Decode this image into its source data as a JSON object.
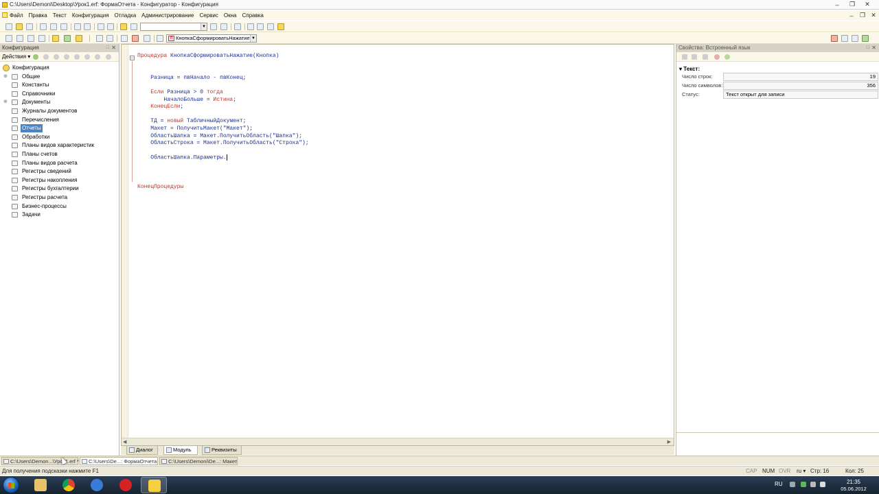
{
  "window": {
    "title": "C:\\Users\\Demoni\\Desktop\\Урок1.erf: ФормаОтчета - Конфигуратор - Конфигурация"
  },
  "menu": [
    "Файл",
    "Правка",
    "Текст",
    "Конфигурация",
    "Отладка",
    "Администрирование",
    "Сервис",
    "Окна",
    "Справка"
  ],
  "toolbar2": {
    "procedure_combo": "КнопкаСформироватьНажатие"
  },
  "left_panel": {
    "title": "Конфигурация",
    "actions_label": "Действия",
    "tree": [
      {
        "label": "Конфигурация",
        "root": true
      },
      {
        "label": "Общие",
        "expandable": true
      },
      {
        "label": "Константы"
      },
      {
        "label": "Справочники"
      },
      {
        "label": "Документы",
        "expandable": true
      },
      {
        "label": "Журналы документов"
      },
      {
        "label": "Перечисления"
      },
      {
        "label": "Отчеты",
        "selected": true
      },
      {
        "label": "Обработки"
      },
      {
        "label": "Планы видов характеристик"
      },
      {
        "label": "Планы счетов"
      },
      {
        "label": "Планы видов расчета"
      },
      {
        "label": "Регистры сведений"
      },
      {
        "label": "Регистры накопления"
      },
      {
        "label": "Регистры бухгалтерии"
      },
      {
        "label": "Регистры расчета"
      },
      {
        "label": "Бизнес-процессы"
      },
      {
        "label": "Задачи"
      }
    ]
  },
  "editor": {
    "code_lines": [
      {
        "text": "Процедура КнопкаСформироватьНажатие(Кнопка)",
        "indent": 0
      },
      {
        "text": "",
        "indent": 0
      },
      {
        "text": "",
        "indent": 0
      },
      {
        "text": "Разница = пвНачало - пвКонец;",
        "indent": 1
      },
      {
        "text": "",
        "indent": 0
      },
      {
        "text": "Если Разница > 0 тогда",
        "indent": 1
      },
      {
        "text": "НачалоБольше = Истина;",
        "indent": 2
      },
      {
        "text": "КонецЕсли;",
        "indent": 1
      },
      {
        "text": "",
        "indent": 0
      },
      {
        "text": "ТД = новый ТабличныйДокумент;",
        "indent": 1
      },
      {
        "text": "Макет = ПолучитьМакет(\"Макет\");",
        "indent": 1
      },
      {
        "text": "ОбластьШапка = Макет.ПолучитьОбласть(\"Шапка\");",
        "indent": 1
      },
      {
        "text": "ОбластьСтрока = Макет.ПолучитьОбласть(\"Строка\");",
        "indent": 1
      },
      {
        "text": "",
        "indent": 0
      },
      {
        "text": "ОбластьШапка.Параметры.",
        "indent": 1,
        "cursor": true
      },
      {
        "text": "",
        "indent": 0
      },
      {
        "text": "",
        "indent": 0
      },
      {
        "text": "",
        "indent": 0
      },
      {
        "text": "КонецПроцедуры",
        "indent": 0
      }
    ],
    "tabs": [
      "Диалог",
      "Модуль",
      "Реквизиты"
    ],
    "active_tab": "Модуль"
  },
  "right_panel": {
    "title": "Свойства: Встроенный язык",
    "group": "Текст:",
    "properties": [
      {
        "label": "Число строк:",
        "value": "19",
        "numeric": true
      },
      {
        "label": "Число символов:",
        "value": "356",
        "numeric": true
      },
      {
        "label": "Статус:",
        "value": "Текст открыт для записи",
        "numeric": false
      }
    ]
  },
  "window_tabs": [
    {
      "label": "C:\\Users\\Demon...\\Урок1.erf *"
    },
    {
      "label": "C:\\Users\\De...: ФормаОтчета",
      "active": true
    },
    {
      "label": "C:\\Users\\Demoni\\De...: Макет"
    }
  ],
  "status_bar": {
    "hint": "Для получения подсказки нажмите F1",
    "cap": "CAP",
    "num": "NUM",
    "ovr": "OVR",
    "lang": "ru",
    "line": "Стр: 16",
    "col": "Кол: 25"
  },
  "taskbar": {
    "lang": "RU",
    "time": "21:35",
    "date": "05.06.2012"
  },
  "colors": {
    "keyword": "#c0342b",
    "identifier": "#1b2f8f",
    "selection": "#4a84c4",
    "chrome": "#fbf8e9"
  }
}
